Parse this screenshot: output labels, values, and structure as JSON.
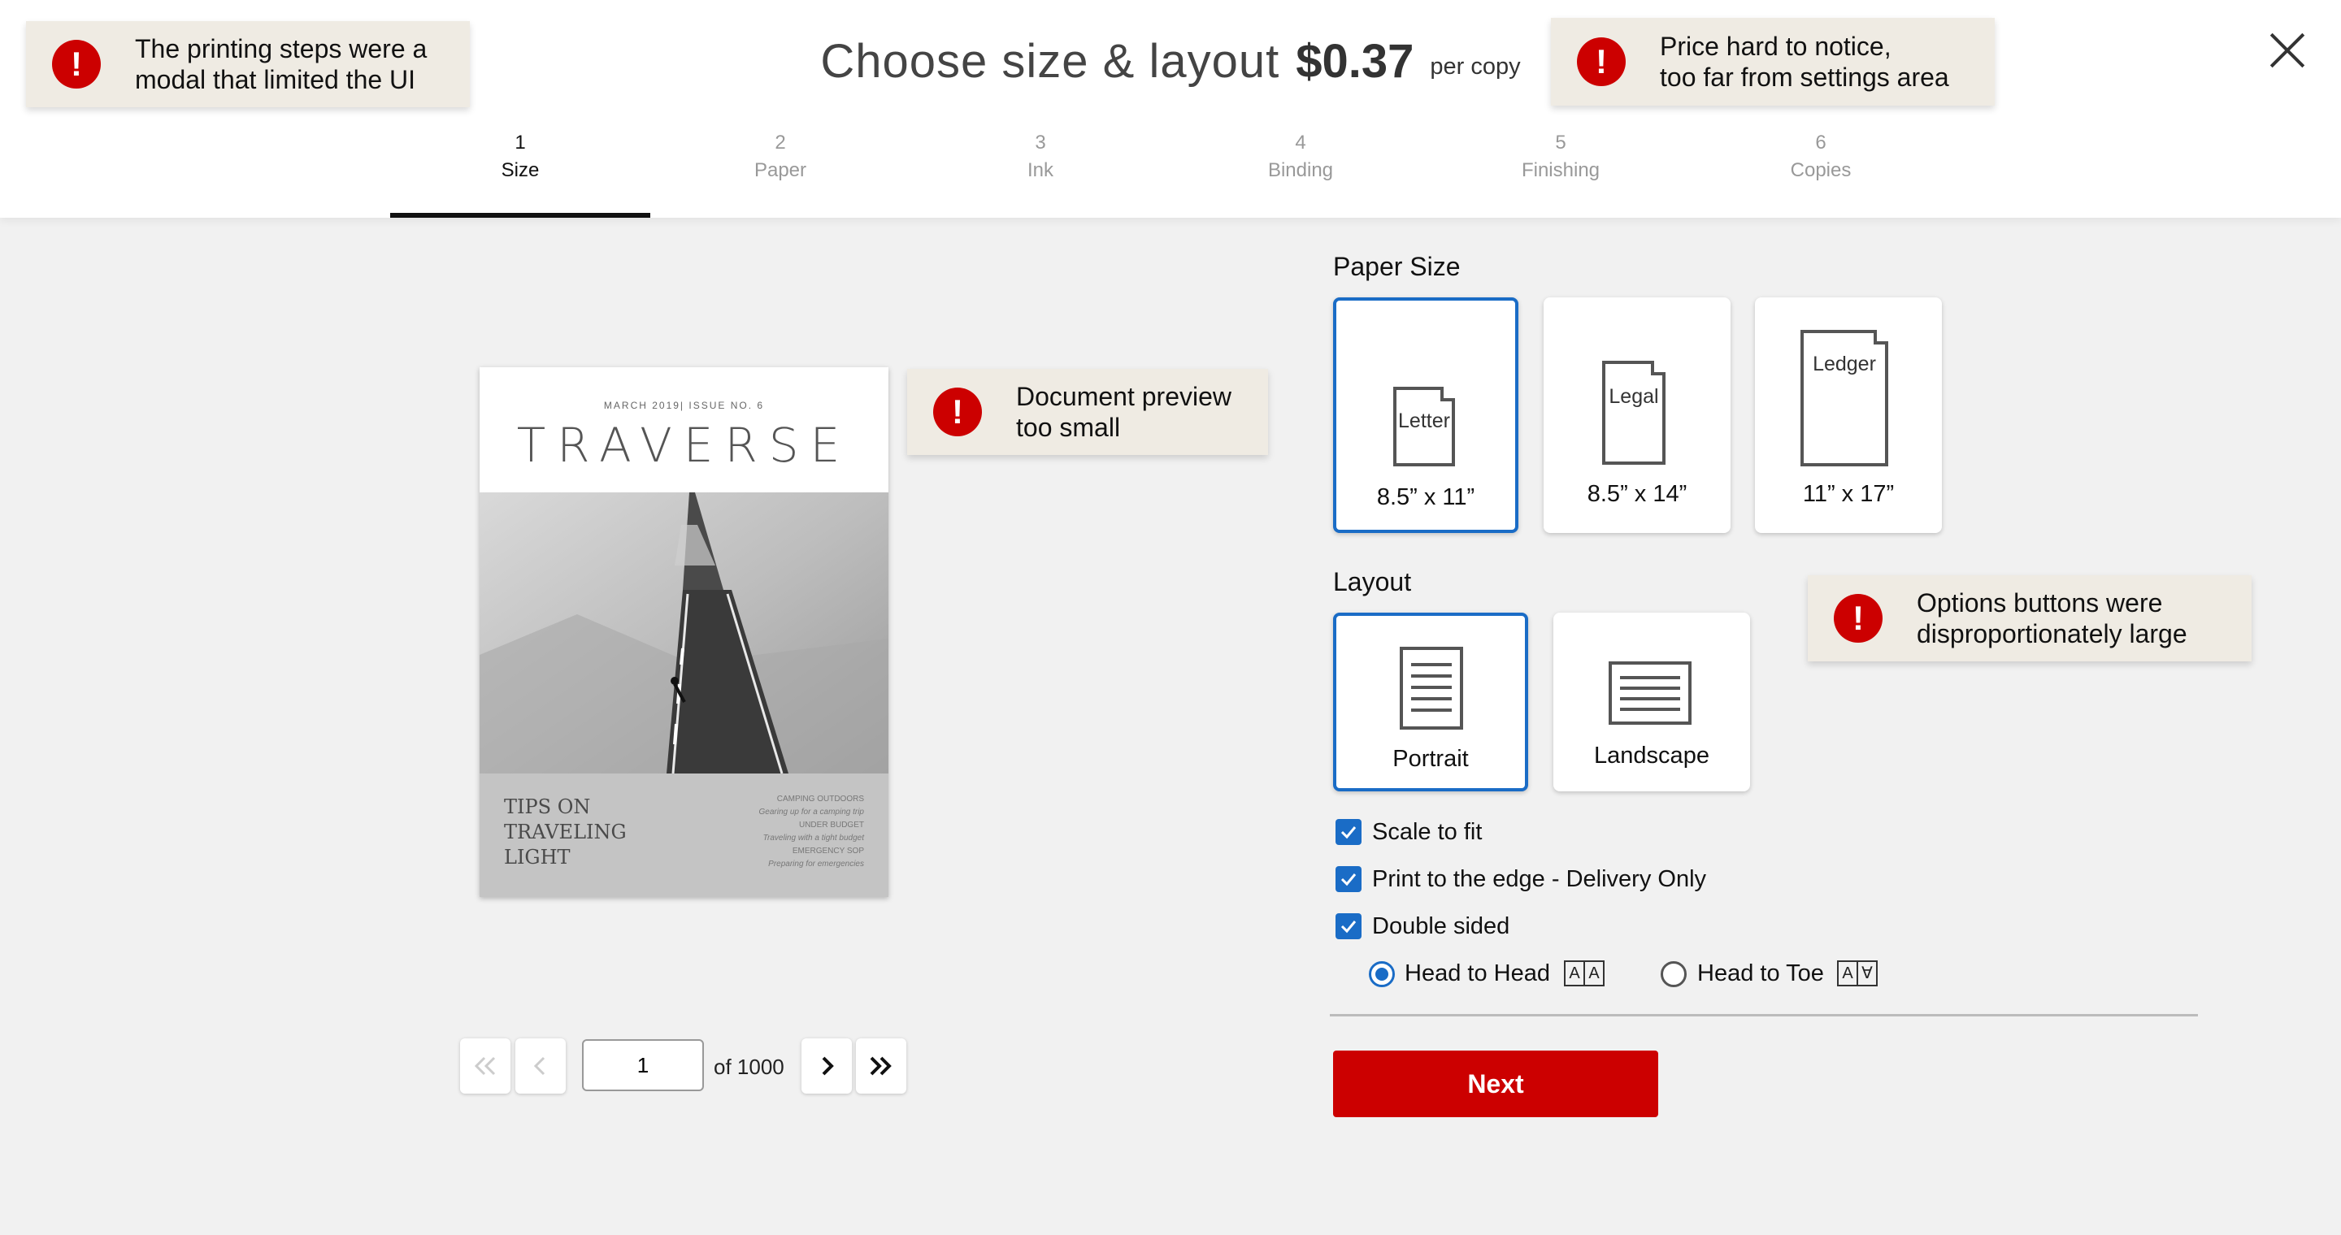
{
  "header": {
    "title": "Choose size & layout",
    "price": "$0.37",
    "per_copy": "per copy",
    "close_icon": "close-icon"
  },
  "steps": [
    {
      "num": "1",
      "label": "Size",
      "active": true
    },
    {
      "num": "2",
      "label": "Paper",
      "active": false
    },
    {
      "num": "3",
      "label": "Ink",
      "active": false
    },
    {
      "num": "4",
      "label": "Binding",
      "active": false
    },
    {
      "num": "5",
      "label": "Finishing",
      "active": false
    },
    {
      "num": "6",
      "label": "Copies",
      "active": false
    }
  ],
  "annotations": [
    {
      "text_line1": "The printing steps were a",
      "text_line2": "modal that limited the UI"
    },
    {
      "text_line1": "Price hard to notice,",
      "text_line2": "too far from settings area"
    },
    {
      "text_line1": "Document preview",
      "text_line2": "too small"
    },
    {
      "text_line1": "Options buttons were",
      "text_line2": "disproportionately large"
    }
  ],
  "annotation_icon": "!",
  "preview": {
    "issue": "MARCH 2019| ISSUE NO. 6",
    "title": "TRAVERSE",
    "tips_line1": "TIPS ON",
    "tips_line2": "TRAVELING",
    "tips_line3": "LIGHT",
    "toc": [
      {
        "head": "CAMPING OUTDOORS",
        "sub": "Gearing up for a camping trip"
      },
      {
        "head": "UNDER BUDGET",
        "sub": "Traveling with a tight budget"
      },
      {
        "head": "EMERGENCY SOP",
        "sub": "Preparing for emergencies"
      }
    ]
  },
  "pager": {
    "page_value": "1",
    "of_text": "of 1000"
  },
  "paper_size": {
    "title": "Paper Size",
    "options": [
      {
        "name": "Letter",
        "dims": "8.5” x 11”",
        "selected": true
      },
      {
        "name": "Legal",
        "dims": "8.5” x 14”",
        "selected": false
      },
      {
        "name": "Ledger",
        "dims": "11” x 17”",
        "selected": false
      }
    ]
  },
  "layout": {
    "title": "Layout",
    "options": [
      {
        "name": "Portrait",
        "selected": true
      },
      {
        "name": "Landscape",
        "selected": false
      }
    ]
  },
  "checkboxes": [
    {
      "label": "Scale to fit",
      "checked": true
    },
    {
      "label": "Print to the edge - Delivery Only",
      "checked": true
    },
    {
      "label": "Double sided",
      "checked": true
    }
  ],
  "radios": [
    {
      "label": "Head to Head",
      "selected": true,
      "glyph_a": "A",
      "glyph_b": "A"
    },
    {
      "label": "Head to Toe",
      "selected": false,
      "glyph_a": "A",
      "glyph_b": "∀"
    }
  ],
  "next_button": "Next",
  "colors": {
    "accent": "#1a6cc6",
    "primary_button": "#cc0000",
    "alert": "#cc0000",
    "note_bg": "#efebe3"
  }
}
